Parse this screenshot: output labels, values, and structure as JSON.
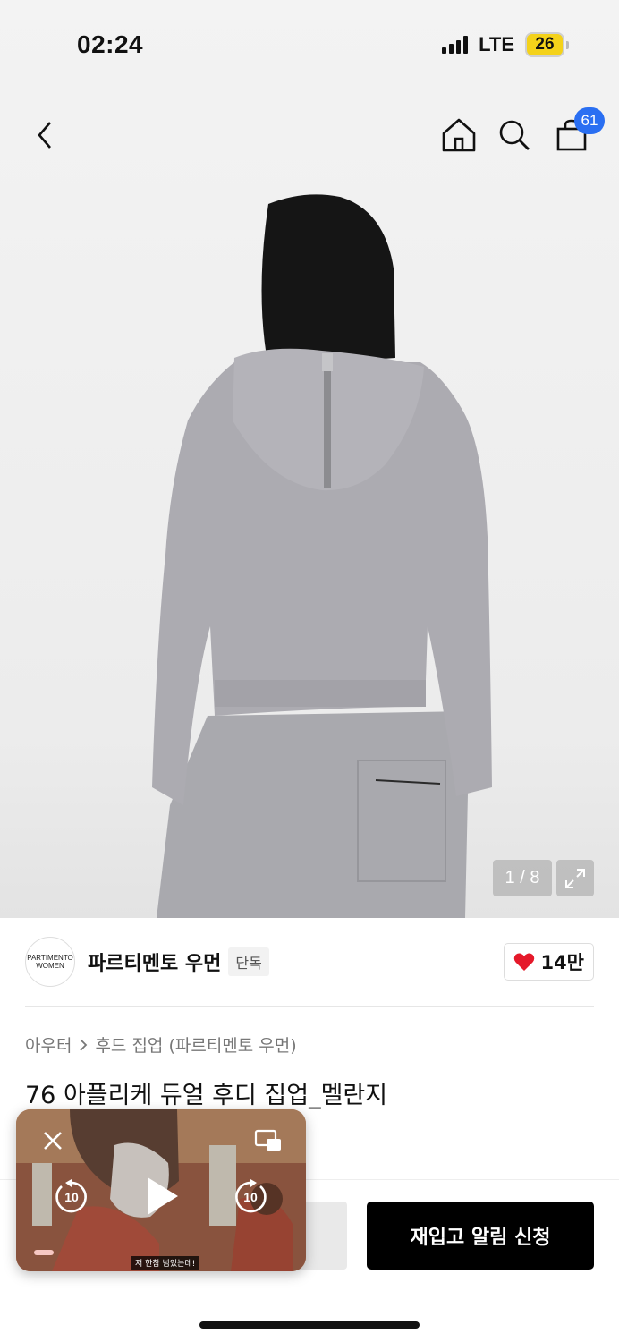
{
  "status_bar": {
    "time": "02:24",
    "network": "LTE",
    "battery": "26"
  },
  "nav": {
    "back_icon": "chevron-left-icon",
    "home_icon": "home-icon",
    "search_icon": "search-icon",
    "cart_icon": "shopping-bag-icon",
    "cart_count": "61"
  },
  "gallery": {
    "counter": "1 / 8",
    "expand_icon": "expand-icon"
  },
  "brand": {
    "logo_line1": "PARTIMENTO",
    "logo_line2": "WOMEN",
    "name": "파르티멘토 우먼",
    "badge": "단독",
    "like_count": "14만"
  },
  "breadcrumb": {
    "category": "아우터",
    "subcategory": "후드 집업 (파르티멘토 우먼)"
  },
  "product": {
    "title": "76 아플리케 듀얼 후디 집업_멜란지"
  },
  "bottom": {
    "restock_label": "재입고 알림 신청"
  },
  "pip": {
    "subtitle": "저 한참 넘었는데!",
    "rewind_label": "10",
    "forward_label": "10"
  },
  "colors": {
    "accent_badge": "#2a6ff2",
    "heart": "#e5192a",
    "primary_button": "#000000"
  }
}
